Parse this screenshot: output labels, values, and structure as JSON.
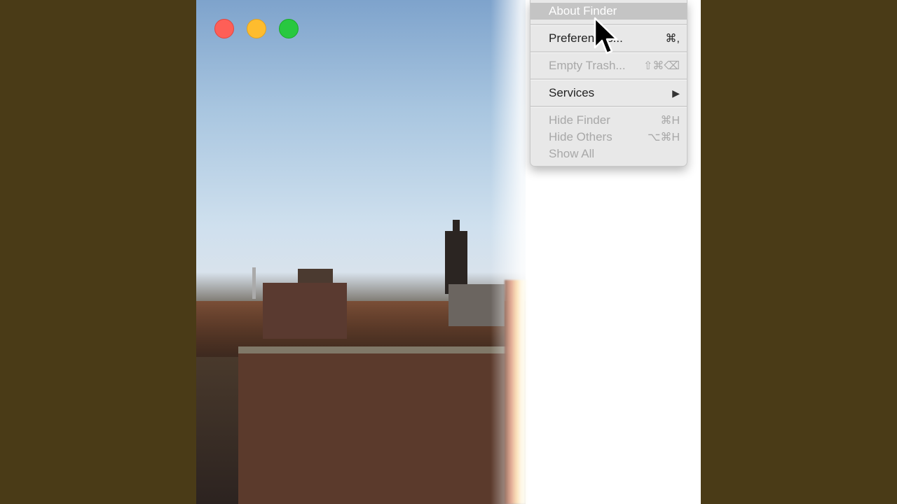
{
  "colors": {
    "background": "#4a3b17",
    "menu_bg": "#e8e8e8",
    "highlight": "#c4c4c4",
    "traffic_red": "#fe5f57",
    "traffic_yellow": "#febc2e",
    "traffic_green": "#28c840"
  },
  "window": {
    "controls": [
      "close",
      "minimize",
      "zoom"
    ]
  },
  "menu": {
    "items": [
      {
        "label": "About Finder",
        "shortcut": "",
        "state": "highlighted"
      },
      {
        "label": "Preferences...",
        "shortcut": "⌘,",
        "state": "enabled"
      },
      {
        "label": "Empty Trash...",
        "shortcut": "⇧⌘⌫",
        "state": "disabled"
      },
      {
        "label": "Services",
        "shortcut": "▶",
        "state": "enabled"
      },
      {
        "label": "Hide Finder",
        "shortcut": "⌘H",
        "state": "disabled"
      },
      {
        "label": "Hide Others",
        "shortcut": "⌥⌘H",
        "state": "disabled"
      },
      {
        "label": "Show All",
        "shortcut": "",
        "state": "disabled"
      }
    ]
  },
  "cursor": {
    "icon": "arrow-cursor-icon"
  }
}
